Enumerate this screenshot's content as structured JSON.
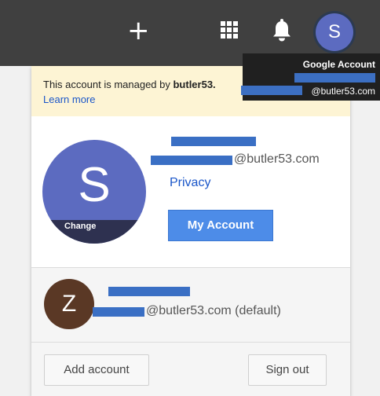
{
  "topbar": {
    "plus_glyph": "+",
    "apps_icon": "apps-grid-icon",
    "notifications_icon": "bell-icon",
    "avatar_letter": "S"
  },
  "tooltip": {
    "title": "Google Account",
    "email_suffix": "@butler53.com"
  },
  "notice": {
    "message_prefix": "This account is managed by ",
    "domain": "butler53.",
    "learn_more": "Learn more"
  },
  "current_account": {
    "avatar_letter": "S",
    "change_label": "Change",
    "email_suffix": "@butler53.com",
    "privacy_label": "Privacy",
    "my_account_label": "My Account"
  },
  "other_account": {
    "avatar_letter": "Z",
    "email_suffix": "@butler53.com (default)"
  },
  "footer": {
    "add_account_label": "Add account",
    "sign_out_label": "Sign out"
  },
  "colors": {
    "topbar": "#404040",
    "accent": "#4d8ce8",
    "avatar_primary": "#5c6bc0",
    "avatar_other": "#5a3825",
    "notice_bg": "#fdf4d4",
    "link": "#1a56c9",
    "redaction": "#3a6fc4"
  }
}
